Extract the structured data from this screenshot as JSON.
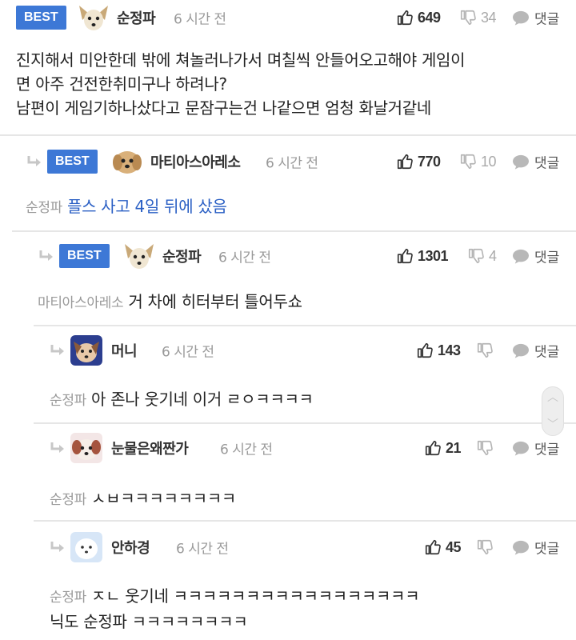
{
  "labels": {
    "best": "BEST",
    "reply": "댓글"
  },
  "comments": [
    {
      "nick": "순정파",
      "time": "6 시간 전",
      "up": "649",
      "down": "34",
      "to": "",
      "lines": [
        "진지해서 미안한데 밖에 쳐놀러나가서 며칠씩 안들어오고해야 게임이",
        "면 아주 건전한취미구나 하려나?",
        "남편이 게임기하나샀다고 문잠구는건 나같으면 엄청 화날거같네"
      ]
    },
    {
      "nick": "마티아스아레소",
      "time": "6 시간 전",
      "up": "770",
      "down": "10",
      "to": "순정파",
      "text": "플스 사고 4일 뒤에 샀음"
    },
    {
      "nick": "순정파",
      "time": "6 시간 전",
      "up": "1301",
      "down": "4",
      "to": "마티아스아레소",
      "text": "거 차에 히터부터 틀어두쇼"
    },
    {
      "nick": "머니",
      "time": "6 시간 전",
      "up": "143",
      "down": "",
      "to": "순정파",
      "text": "아 존나 웃기네 이거 ㄹㅇㅋㅋㅋㅋ"
    },
    {
      "nick": "눈물은왜짠가",
      "time": "6 시간 전",
      "up": "21",
      "down": "",
      "to": "순정파",
      "text": "ㅅㅂㅋㅋㅋㅋㅋㅋㅋㅋ"
    },
    {
      "nick": "안하경",
      "time": "6 시간 전",
      "up": "45",
      "down": "",
      "to": "순정파",
      "text": "ㅈㄴ 웃기네 ㅋㅋㅋㅋㅋㅋㅋㅋㅋㅋㅋㅋㅋㅋㅋㅋㅋ",
      "text2": "닉도 순정파 ㅋㅋㅋㅋㅋㅋㅋㅋ"
    }
  ],
  "colors": {
    "best_badge": "#3d78d6",
    "reply_target": "#2a5fc4",
    "icon_gray": "#b5b5b5"
  },
  "icons": [
    "thumbs-up-icon",
    "thumbs-down-icon",
    "speech-bubble-icon",
    "reply-arrow-icon",
    "chevron-up-icon",
    "chevron-down-icon"
  ]
}
